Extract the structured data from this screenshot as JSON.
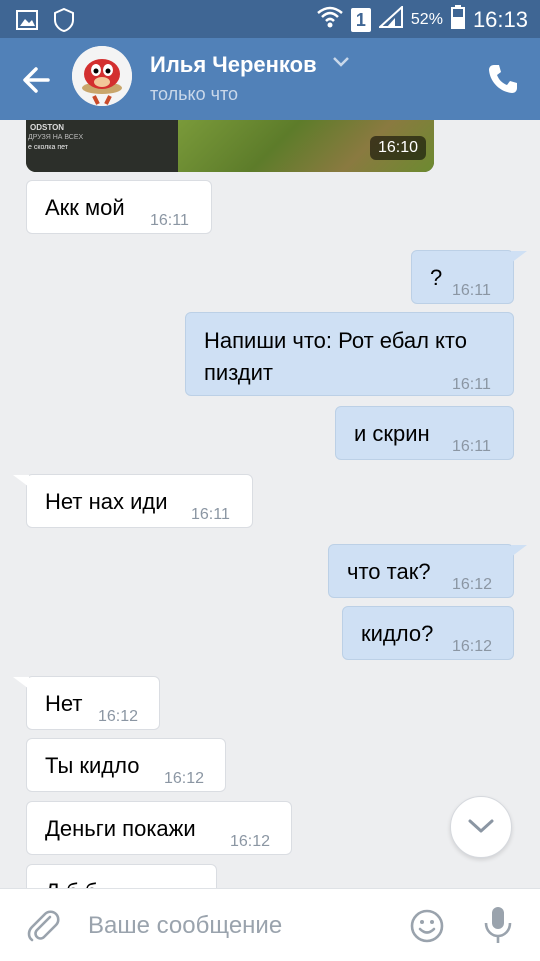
{
  "status_bar": {
    "battery": "52%",
    "time": "16:13",
    "sim_badge": "1"
  },
  "header": {
    "contact_name": "Илья Черенков",
    "contact_status": "только что"
  },
  "image_message": {
    "overlay_top": "ODSTON",
    "overlay_mid": "ДРУЗЯ НА ВСЕХ",
    "overlay_bottom": "е сколка пет",
    "time": "16:10"
  },
  "messages": [
    {
      "dir": "in",
      "text": "Акк мой",
      "time": "16:11"
    },
    {
      "dir": "out",
      "text": "?",
      "time": "16:11"
    },
    {
      "dir": "out",
      "text": "Напиши что: Рот ебал кто пиздит",
      "time": "16:11"
    },
    {
      "dir": "out",
      "text": "и скрин",
      "time": "16:11"
    },
    {
      "dir": "in",
      "text": "Нет нах иди",
      "time": "16:11"
    },
    {
      "dir": "out",
      "text": "что так?",
      "time": "16:12"
    },
    {
      "dir": "out",
      "text": "кидло?",
      "time": "16:12"
    },
    {
      "dir": "in",
      "text": "Нет",
      "time": "16:12"
    },
    {
      "dir": "in",
      "text": "Ты кидло",
      "time": "16:12"
    },
    {
      "dir": "in",
      "text": "Деньги покажи",
      "time": "16:12"
    },
    {
      "dir": "in",
      "text": "Д б б",
      "time": ""
    }
  ],
  "composer": {
    "placeholder": "Ваше сообщение"
  },
  "colors": {
    "status_bar": "#3f6694",
    "app_bar": "#5181b8",
    "chat_bg": "#edeef0",
    "incoming": "#ffffff",
    "outgoing": "#cfe0f4"
  }
}
